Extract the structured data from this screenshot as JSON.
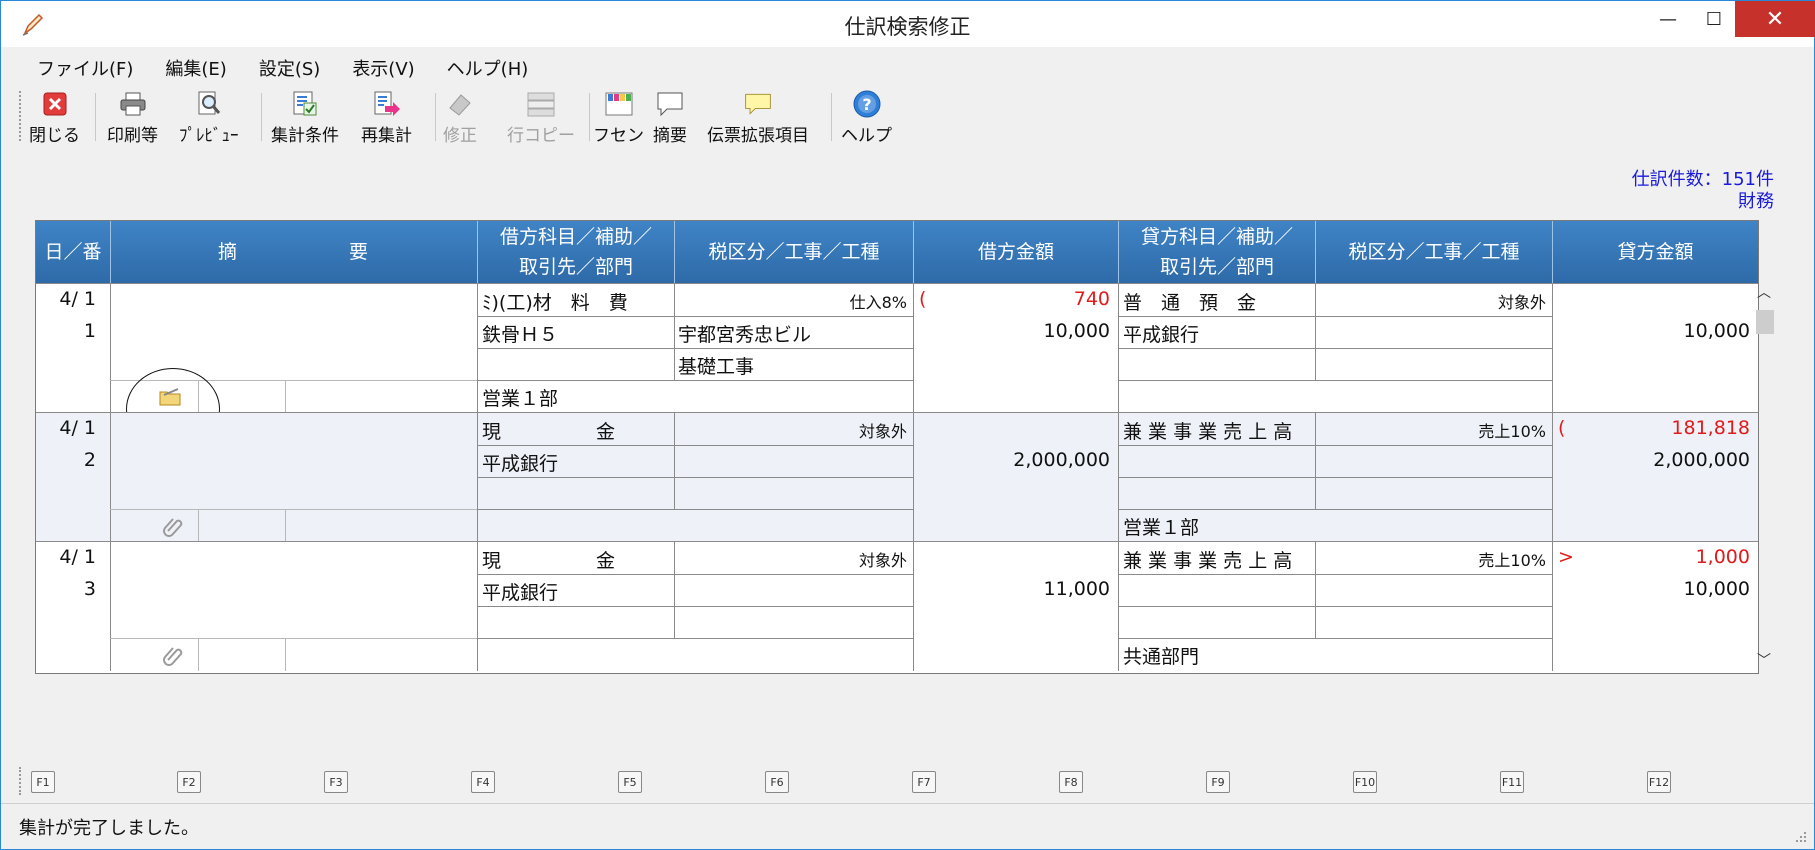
{
  "window": {
    "title": "仕訳検索修正",
    "minimize": "—",
    "maximize": "☐",
    "close": "✕"
  },
  "menu": [
    "ファイル(F)",
    "編集(E)",
    "設定(S)",
    "表示(V)",
    "ヘルプ(H)"
  ],
  "toolbar": {
    "close": "閉じる",
    "print": "印刷等",
    "preview": "ﾌﾟﾚﾋﾞｭｰ",
    "agg_cond": "集計条件",
    "reagg": "再集計",
    "edit": "修正",
    "rowcopy": "行コピー",
    "fusen": "フセン",
    "summary": "摘要",
    "slip_ext": "伝票拡張項目",
    "help": "ヘルプ"
  },
  "info": {
    "count": "仕訳件数：151件",
    "mode": "財務"
  },
  "headers": {
    "date_no": "日／番",
    "summary1": "摘",
    "summary2": "要",
    "debit_account1": "借方科目／補助／",
    "debit_account2": "取引先／部門",
    "debit_tax": "税区分／工事／工種",
    "debit_amount": "借方金額",
    "credit_account1": "貸方科目／補助／",
    "credit_account2": "取引先／部門",
    "credit_tax": "税区分／工事／工種",
    "credit_amount": "貸方金額"
  },
  "rows": [
    {
      "date": "4/ 1",
      "no": "1",
      "debit_acc": "ﾐ)(工)材　料　費",
      "debit_sub": "鉄骨Ｈ５",
      "debit_dept": "営業１部",
      "debit_tax": "仕入8%",
      "debit_proj": "宇都宮秀忠ビル",
      "debit_work": "基礎工事",
      "debit_mark": "(",
      "debit_tax_amount": "740",
      "debit_amount": "10,000",
      "credit_acc": "普　通　預　金",
      "credit_sub": "平成銀行",
      "credit_dept": "",
      "credit_tax": "対象外",
      "credit_mark": "",
      "credit_tax_amount": "",
      "credit_amount": "10,000"
    },
    {
      "date": "4/ 1",
      "no": "2",
      "debit_acc": "現　　　　　金",
      "debit_sub": "平成銀行",
      "debit_dept": "",
      "debit_tax": "対象外",
      "debit_proj": "",
      "debit_work": "",
      "debit_mark": "",
      "debit_tax_amount": "",
      "debit_amount": "2,000,000",
      "credit_acc": "兼 業 事 業 売 上 高",
      "credit_sub": "",
      "credit_dept": "営業１部",
      "credit_tax": "売上10%",
      "credit_mark": "(",
      "credit_tax_amount": "181,818",
      "credit_amount": "2,000,000"
    },
    {
      "date": "4/ 1",
      "no": "3",
      "debit_acc": "現　　　　　金",
      "debit_sub": "平成銀行",
      "debit_dept": "",
      "debit_tax": "対象外",
      "debit_proj": "",
      "debit_work": "",
      "debit_mark": "",
      "debit_tax_amount": "",
      "debit_amount": "11,000",
      "credit_acc": "兼 業 事 業 売 上 高",
      "credit_sub": "",
      "credit_dept": "共通部門",
      "credit_tax": "売上10%",
      "credit_mark": ">",
      "credit_tax_amount": "1,000",
      "credit_amount": "10,000"
    }
  ],
  "fkeys": [
    "F1",
    "F2",
    "F3",
    "F4",
    "F5",
    "F6",
    "F7",
    "F8",
    "F9",
    "F10",
    "F11",
    "F12"
  ],
  "status": "集計が完了しました。"
}
